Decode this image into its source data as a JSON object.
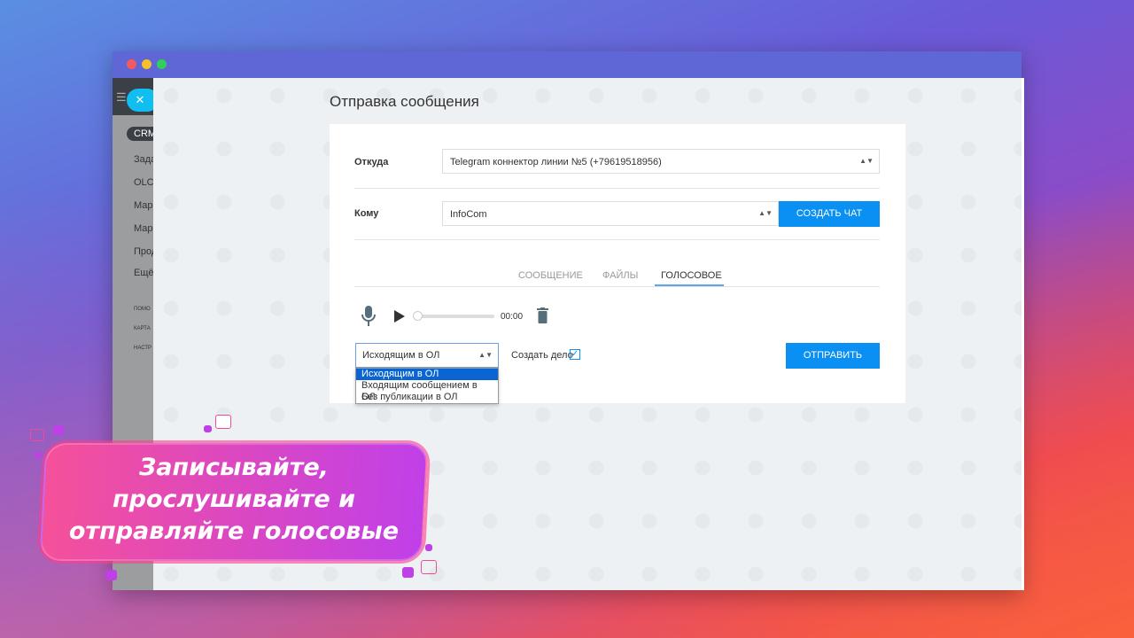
{
  "sidebar": {
    "crm": "CRM",
    "items": [
      "Зада",
      "OLCH",
      "Мар",
      "Мар",
      "Прод",
      "Ещё"
    ],
    "small": [
      "ПОМО",
      "КАРТА",
      "НАСТР"
    ]
  },
  "page": {
    "title": "Отправка сообщения"
  },
  "form": {
    "from_label": "Откуда",
    "from_value": "Telegram коннектор линии №5 (+79619518956)",
    "to_label": "Кому",
    "to_value": "InfoCom",
    "create_chat": "СОЗДАТЬ ЧАТ",
    "tabs": [
      "СООБЩЕНИЕ",
      "ФАЙЛЫ",
      "ГОЛОСОВОЕ"
    ],
    "active_tab": "ГОЛОСОВОЕ",
    "time": "00:00",
    "progress": 0,
    "publish_value": "Исходящим в ОЛ",
    "publish_options": [
      "Исходящим в ОЛ",
      "Входящим сообщением в ОЛ",
      "Без публикации в ОЛ"
    ],
    "create_task_label": "Создать дело",
    "create_task_checked": true,
    "send": "ОТПРАВИТЬ"
  },
  "banner": {
    "lines": [
      "Записывайте,",
      "прослушивайте и",
      "отправляйте голосовые"
    ]
  },
  "colors": {
    "accent": "#0a8ff2",
    "close": "#10bff0",
    "sidebar_dark": "#3b4047"
  }
}
